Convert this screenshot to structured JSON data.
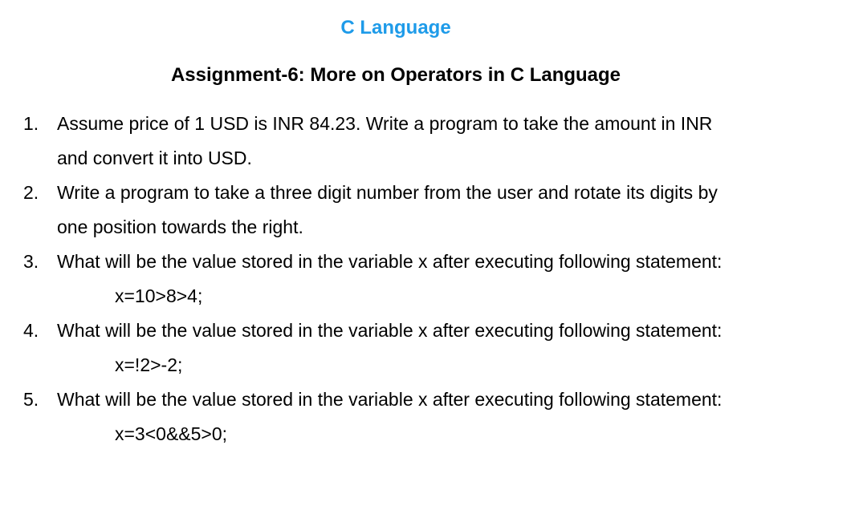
{
  "document": {
    "subject_title": "C Language",
    "assignment_title": "Assignment-6: More on Operators in C Language",
    "questions": [
      {
        "number": "1.",
        "lines": [
          "Assume price of 1 USD is INR 84.23. Write a program to take the amount in INR",
          "and convert it into USD."
        ]
      },
      {
        "number": "2.",
        "lines": [
          "Write a program to take a three digit number from the user and rotate its digits by",
          "one position towards the right."
        ]
      },
      {
        "number": "3.",
        "lines": [
          "What will be the value stored in the variable x after executing following statement:"
        ],
        "code": "x=10>8>4;"
      },
      {
        "number": "4.",
        "lines": [
          "What will be the value stored in the variable x after executing following statement:"
        ],
        "code": "x=!2>-2;"
      },
      {
        "number": "5.",
        "lines": [
          "What will be the value stored in the variable x after executing following statement:"
        ],
        "code": "x=3<0&&5>0;"
      }
    ]
  }
}
